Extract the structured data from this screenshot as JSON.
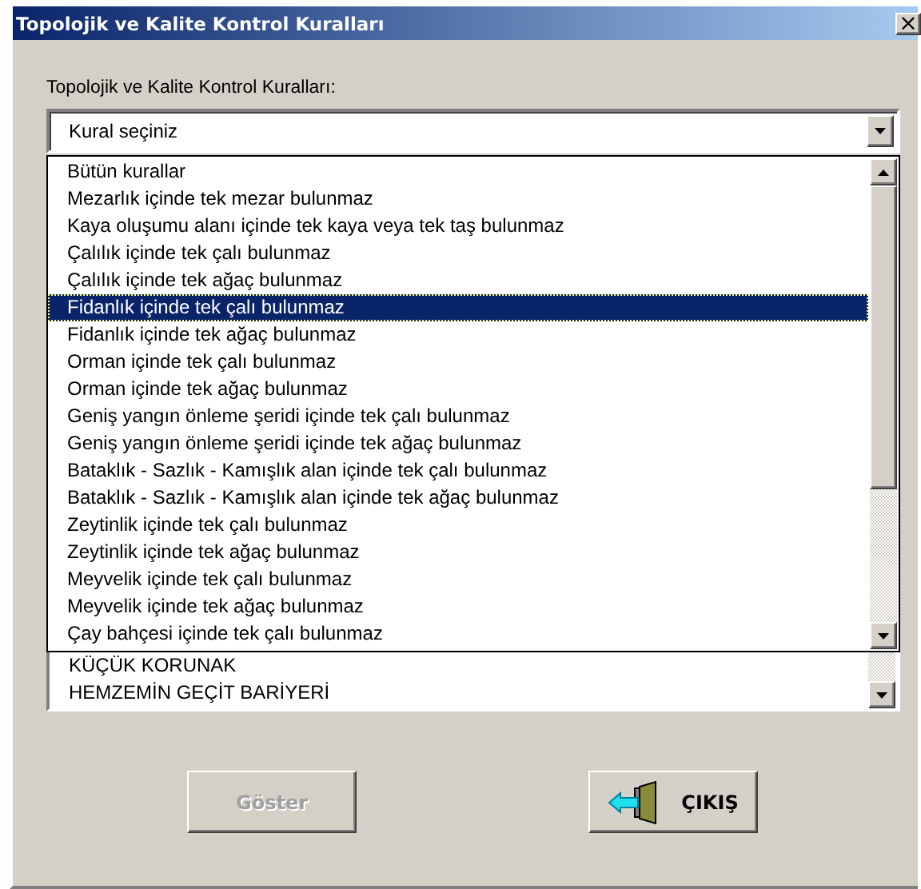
{
  "window": {
    "title": "Topolojik ve Kalite Kontrol Kuralları",
    "close": "×"
  },
  "rules_label": "Topolojik ve Kalite Kontrol Kuralları:",
  "rule_combo": {
    "value": "Kural seçiniz",
    "expanded": true,
    "items": [
      {
        "label": "Bütün kurallar",
        "selected": false
      },
      {
        "label": "Mezarlık içinde tek mezar bulunmaz",
        "selected": false
      },
      {
        "label": "Kaya oluşumu alanı içinde tek kaya veya tek taş bulunmaz",
        "selected": false
      },
      {
        "label": "Çalılık içinde tek çalı bulunmaz",
        "selected": false
      },
      {
        "label": "Çalılık içinde tek ağaç bulunmaz",
        "selected": false
      },
      {
        "label": "Fidanlık içinde tek çalı bulunmaz",
        "selected": true
      },
      {
        "label": "Fidanlık içinde tek ağaç bulunmaz",
        "selected": false
      },
      {
        "label": "Orman içinde tek çalı bulunmaz",
        "selected": false
      },
      {
        "label": "Orman içinde tek ağaç bulunmaz",
        "selected": false
      },
      {
        "label": "Geniş yangın önleme şeridi içinde tek çalı bulunmaz",
        "selected": false
      },
      {
        "label": "Geniş yangın önleme şeridi içinde tek ağaç bulunmaz",
        "selected": false
      },
      {
        "label": "Bataklık - Sazlık - Kamışlık alan içinde tek çalı bulunmaz",
        "selected": false
      },
      {
        "label": "Bataklık - Sazlık - Kamışlık alan içinde tek ağaç bulunmaz",
        "selected": false
      },
      {
        "label": "Zeytinlik içinde tek çalı bulunmaz",
        "selected": false
      },
      {
        "label": "Zeytinlik içinde tek ağaç bulunmaz",
        "selected": false
      },
      {
        "label": "Meyvelik içinde tek çalı bulunmaz",
        "selected": false
      },
      {
        "label": "Meyvelik içinde tek ağaç bulunmaz",
        "selected": false
      },
      {
        "label": "Çay bahçesi içinde tek çalı bulunmaz",
        "selected": false
      }
    ]
  },
  "feature_list": {
    "items": [
      "KÜÇÜK KORUNAK",
      "HEMZEMİN GEÇİT BARİYERİ"
    ]
  },
  "buttons": [
    {
      "label": "Göster",
      "kind": "show",
      "disabled": true
    },
    {
      "label": "ÇIKIŞ",
      "kind": "exit",
      "disabled": false
    }
  ]
}
